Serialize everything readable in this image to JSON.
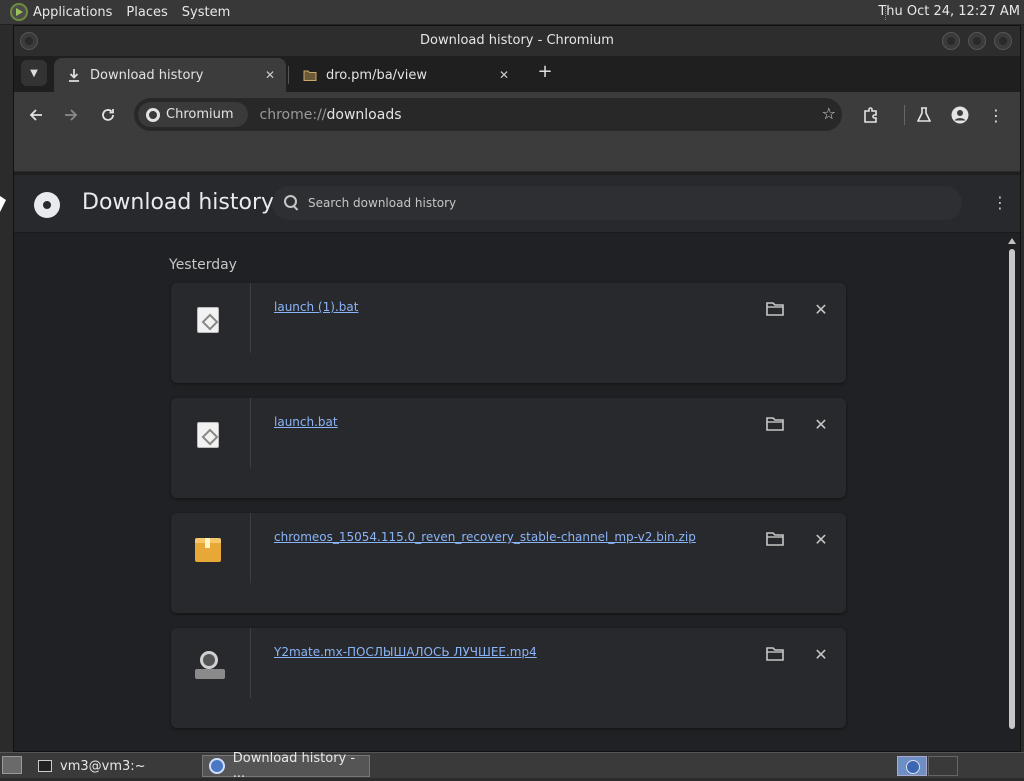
{
  "system_panel": {
    "menus": [
      "Applications",
      "Places",
      "System"
    ],
    "clock": "Thu Oct 24, 12:27 AM"
  },
  "window": {
    "title": "Download history - Chromium"
  },
  "tabs": [
    {
      "title": "Download history",
      "icon": "download-icon",
      "active": true
    },
    {
      "title": "dro.pm/ba/view",
      "icon": "folder-icon",
      "active": false
    }
  ],
  "toolbar": {
    "omnibox_chip": "Chromium",
    "url_prefix": "chrome://",
    "url_host": "downloads"
  },
  "downloads_page": {
    "title": "Download history",
    "search_placeholder": "Search download history",
    "section_date": "Yesterday",
    "items": [
      {
        "file_name": "launch (1).bat",
        "icon": "bat-file-icon"
      },
      {
        "file_name": "launch.bat",
        "icon": "bat-file-icon"
      },
      {
        "file_name": "chromeos_15054.115.0_reven_recovery_stable-channel_mp-v2.bin.zip",
        "icon": "zip-file-icon"
      },
      {
        "file_name": "Y2mate.mx-ПОСЛЫШАЛОСЬ ЛУЧШЕЕ.mp4",
        "icon": "video-file-icon"
      }
    ]
  },
  "taskbar": {
    "items": [
      {
        "label": "vm3@vm3:~",
        "icon": "terminal-icon"
      },
      {
        "label": "Download history - ...",
        "icon": "chromium-icon"
      }
    ]
  },
  "colors": {
    "page_bg": "#202124",
    "card_bg": "#28292c",
    "link": "#8ab4f8",
    "toolbar_bg": "#3c3c3c"
  }
}
